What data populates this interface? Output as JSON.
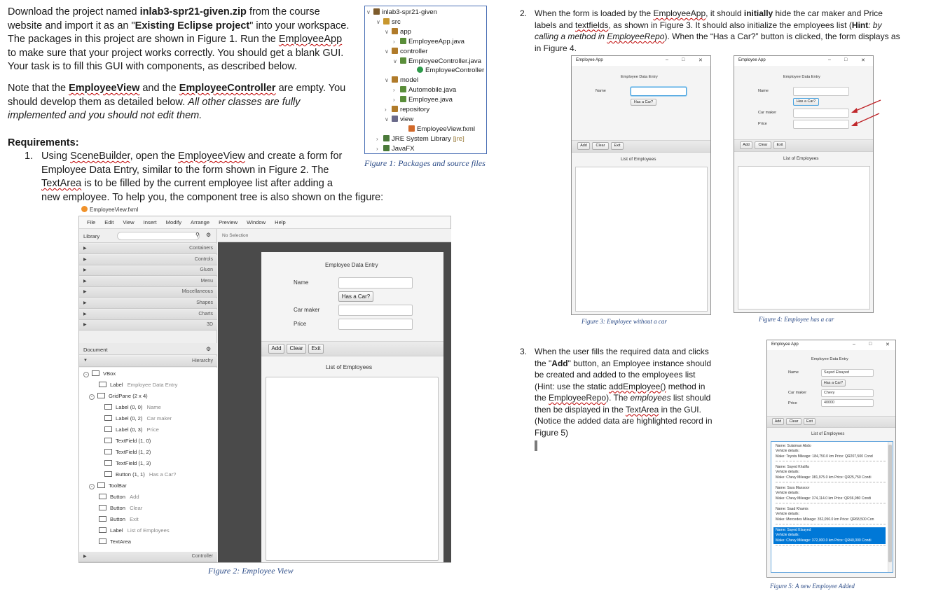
{
  "intro": {
    "l1a": "Download the project named ",
    "l1b": "inlab3-spr21-given.zip",
    "l1c": " from the course",
    "l2a": "website and import it as an \"",
    "l2b": "Existing Eclipse project",
    "l2c": "\" into your workspace.",
    "l3a": "The packages in this project are shown in Figure 1. Run the ",
    "l3b": "EmployeeApp",
    "l4": "to make sure that your project works correctly. You should get a blank GUI.",
    "l5": "Your task is to fill this GUI with components, as described below."
  },
  "note": {
    "l1a": "Note that the ",
    "l1b": "EmployeeView",
    "l1c": " and the ",
    "l1d": "EmployeeController",
    "l1e": " are empty. You",
    "l2": "should develop them as detailed below. ",
    "l2i": "All other classes are fully",
    "l3i": "implemented and you should not edit them."
  },
  "req": {
    "title": "Requirements:",
    "n1": "1.",
    "r1a": "Using ",
    "r1b": "SceneBuilder",
    "r1c": ", open the ",
    "r1d": "EmployeeView",
    "r1e": " and create a form for",
    "r2": "Employee Data Entry, similar to the form shown in Figure 2. The",
    "r3a": "TextArea",
    "r3b": " is to be filled by the current employee list after adding a",
    "r4": "new employee. To help you, the component tree is also shown on the figure:"
  },
  "tree": {
    "rows": [
      {
        "t": "inlab3-spr21-given",
        "tw": "v"
      },
      {
        "t": "src",
        "tw": "v"
      },
      {
        "t": "app",
        "tw": "v"
      },
      {
        "t": "EmployeeApp.java",
        "tw": ">"
      },
      {
        "t": "controller",
        "tw": "v"
      },
      {
        "t": "EmployeeController.java",
        "tw": "v"
      },
      {
        "t": "EmployeeController",
        "tw": ""
      },
      {
        "t": "model",
        "tw": "v"
      },
      {
        "t": "Automobile.java",
        "tw": ">"
      },
      {
        "t": "Employee.java",
        "tw": ">"
      },
      {
        "t": "repository",
        "tw": ">"
      },
      {
        "t": "view",
        "tw": "v"
      },
      {
        "t": "EmployeeView.fxml",
        "tw": ""
      },
      {
        "t": "JRE System Library",
        "tw": ">",
        "extra": "[jre]"
      },
      {
        "t": "JavaFX",
        "tw": ">"
      }
    ],
    "caption": "Figure 1: Packages and source files"
  },
  "sb": {
    "filename": "EmployeeView.fxml",
    "menu": [
      "File",
      "Edit",
      "View",
      "Insert",
      "Modify",
      "Arrange",
      "Preview",
      "Window",
      "Help"
    ],
    "library": "Library",
    "no_selection": "No Selection",
    "sections": [
      "Containers",
      "Controls",
      "Gluon",
      "Menu",
      "Miscellaneous",
      "Shapes",
      "Charts",
      "3D"
    ],
    "document": "Document",
    "hierarchy": "Hierarchy",
    "controller": "Controller",
    "nodes": [
      {
        "t": "VBox",
        "s": ""
      },
      {
        "t": "Label",
        "s": "Employee Data Entry"
      },
      {
        "t": "GridPane (2 x 4)",
        "s": ""
      },
      {
        "t": "Label (0, 0)",
        "s": "Name"
      },
      {
        "t": "Label (0, 2)",
        "s": "Car maker"
      },
      {
        "t": "Label (0, 3)",
        "s": "Price"
      },
      {
        "t": "TextField (1, 0)",
        "s": ""
      },
      {
        "t": "TextField (1, 2)",
        "s": ""
      },
      {
        "t": "TextField (1, 3)",
        "s": ""
      },
      {
        "t": "Button (1, 1)",
        "s": "Has a Car?"
      },
      {
        "t": "ToolBar",
        "s": ""
      },
      {
        "t": "Button",
        "s": "Add"
      },
      {
        "t": "Button",
        "s": "Clear"
      },
      {
        "t": "Button",
        "s": "Exit"
      },
      {
        "t": "Label",
        "s": "List of Employees"
      },
      {
        "t": "TextArea",
        "s": ""
      }
    ],
    "form": {
      "title": "Employee Data Entry",
      "name": "Name",
      "has_car": "Has a Car?",
      "car_maker": "Car maker",
      "price": "Price",
      "add": "Add",
      "clear": "Clear",
      "exit": "Exit",
      "list": "List of Employees"
    },
    "caption": "Figure 2: Employee View"
  },
  "req2": {
    "n": "2.",
    "l1a": "When the form is loaded by the ",
    "l1b": "EmployeeApp",
    "l1c": ", it should ",
    "l1d": "initially",
    "l1e": " hide the car maker and Price",
    "l2a": "labels and ",
    "l2b": "textfields",
    "l2c": ", as shown in Figure 3. It should also initialize the employees list (",
    "l2d": "Hint",
    "l2e": ": by",
    "l3a": "calling a method in ",
    "l3b": "EmployeeRepo",
    "l3c": "). When the “Has a Car?” button is clicked, the form displays as",
    "l4": "in Figure 4."
  },
  "fig3": {
    "title": "Employee App",
    "form_title": "Employee Data Entry",
    "name": "Name",
    "has_car": "Has a Car?",
    "add": "Add",
    "clear": "Clear",
    "exit": "Exit",
    "list": "List of Employees",
    "caption": "Figure 3: Employee without a car"
  },
  "fig4": {
    "title": "Employee App",
    "form_title": "Employee Data Entry",
    "name": "Name",
    "has_car": "Has a Car?",
    "car_maker": "Car maker",
    "price": "Price",
    "add": "Add",
    "clear": "Clear",
    "exit": "Exit",
    "list": "List of Employees",
    "caption": "Figure 4:  Employee has a car"
  },
  "req3": {
    "n": "3.",
    "l1a": "When the user fills the required data and clicks",
    "l2a": "the \"",
    "l2b": "Add",
    "l2c": "\" button, an Employee instance should",
    "l3": "be created and added to the employees list",
    "l4a": "(Hint: use the static ",
    "l4b": "addEmployee()",
    "l4c": " method in",
    "l5a": "the ",
    "l5b": "EmployeeRepo",
    "l5c": "). The ",
    "l5d": "employees",
    "l5e": " list should",
    "l6a": "then be displayed in the ",
    "l6b": "TextArea",
    "l6c": " in the GUI.",
    "l7": "(Notice the added data are highlighted record in",
    "l8": "Figure 5)"
  },
  "fig5": {
    "title": "Employee App",
    "form_title": "Employee Data Entry",
    "name": "Name",
    "name_val": "Sayed Elsayed",
    "has_car": "Has a Car?",
    "car_maker": "Car maker",
    "car_val": "Chevy",
    "price": "Price",
    "price_val": "40000",
    "add": "Add",
    "clear": "Clear",
    "exit": "Exit",
    "list": "List of Employees",
    "records": [
      {
        "n": "Name: Sulaiman Abdo",
        "v": "Vehicle details:",
        "m": "Make: Toyota    Mileage: 184,750.0 km  Price: QR207,500 Cond"
      },
      {
        "n": "Name: Sayed Khalifa",
        "v": "Vehicle details:",
        "m": "Make: Chevy    Mileage: 381,975.0 km  Price: QR25,750 Condi"
      },
      {
        "n": "Name: Sara Mansoor",
        "v": "Vehicle details:",
        "m": "Make: Chevy    Mileage: 374,114.0 km  Price: QR36,980 Condi"
      },
      {
        "n": "Name: Saad Khamis",
        "v": "Vehicle details:",
        "m": "Make: Mercedes   Mileage: 352,050.0 km  Price: QR68,500 Con"
      },
      {
        "n": "Name: Sayed Elsayed",
        "v": "Vehicle details:",
        "m": "Make: Chevy    Mileage: 372,000.0 km  Price: QR40,000 Condi"
      }
    ],
    "caption": "Figure 5: A new Employee Added"
  },
  "colors": {
    "accent": "#2a4a86",
    "highlight": "#0078d7",
    "arrow": "#c0282c"
  }
}
